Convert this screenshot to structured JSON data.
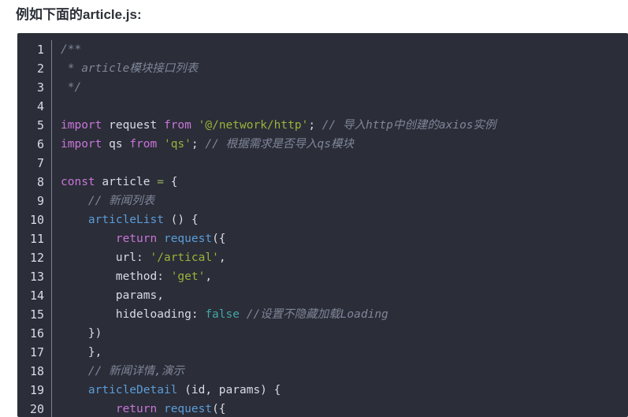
{
  "heading": {
    "text": "例如下面的article.js:"
  },
  "colors": {
    "page_background": "#ffffff",
    "heading_text": "#2c3038",
    "code_background": "#2b2d38",
    "gutter_text": "#d8dce4",
    "comment": "#7f8699",
    "keyword": "#c876d8",
    "string": "#9ab33a",
    "function": "#5b9dd9",
    "boolean": "#3fa8a8",
    "plain": "#d8dce4"
  },
  "code_block": {
    "language": "javascript",
    "filename": "article.js",
    "first_visible_line": 1,
    "last_visible_line": 20,
    "lines": [
      {
        "number": "1",
        "tokens": [
          {
            "type": "comment",
            "text": "/**"
          }
        ]
      },
      {
        "number": "2",
        "tokens": [
          {
            "type": "comment",
            "text": " * article模块接口列表"
          }
        ]
      },
      {
        "number": "3",
        "tokens": [
          {
            "type": "comment",
            "text": " */"
          }
        ]
      },
      {
        "number": "4",
        "tokens": [
          {
            "type": "plain",
            "text": ""
          }
        ]
      },
      {
        "number": "5",
        "tokens": [
          {
            "type": "keyword",
            "text": "import"
          },
          {
            "type": "plain",
            "text": " request "
          },
          {
            "type": "keyword",
            "text": "from"
          },
          {
            "type": "plain",
            "text": " "
          },
          {
            "type": "string",
            "text": "'@/network/http'"
          },
          {
            "type": "plain",
            "text": "; "
          },
          {
            "type": "comment",
            "text": "// 导入http中创建的axios实例"
          }
        ]
      },
      {
        "number": "6",
        "tokens": [
          {
            "type": "keyword",
            "text": "import"
          },
          {
            "type": "plain",
            "text": " qs "
          },
          {
            "type": "keyword",
            "text": "from"
          },
          {
            "type": "plain",
            "text": " "
          },
          {
            "type": "string",
            "text": "'qs'"
          },
          {
            "type": "plain",
            "text": "; "
          },
          {
            "type": "comment",
            "text": "// 根据需求是否导入qs模块"
          }
        ]
      },
      {
        "number": "7",
        "tokens": [
          {
            "type": "plain",
            "text": ""
          }
        ]
      },
      {
        "number": "8",
        "tokens": [
          {
            "type": "keyword",
            "text": "const"
          },
          {
            "type": "plain",
            "text": " article "
          },
          {
            "type": "operator",
            "text": "="
          },
          {
            "type": "plain",
            "text": " {"
          }
        ]
      },
      {
        "number": "9",
        "tokens": [
          {
            "type": "plain",
            "text": "    "
          },
          {
            "type": "comment",
            "text": "// 新闻列表"
          }
        ]
      },
      {
        "number": "10",
        "tokens": [
          {
            "type": "plain",
            "text": "    "
          },
          {
            "type": "func",
            "text": "articleList"
          },
          {
            "type": "plain",
            "text": " () {"
          }
        ]
      },
      {
        "number": "11",
        "tokens": [
          {
            "type": "plain",
            "text": "        "
          },
          {
            "type": "keyword",
            "text": "return"
          },
          {
            "type": "plain",
            "text": " "
          },
          {
            "type": "func",
            "text": "request"
          },
          {
            "type": "plain",
            "text": "({"
          }
        ]
      },
      {
        "number": "12",
        "tokens": [
          {
            "type": "plain",
            "text": "        url: "
          },
          {
            "type": "string",
            "text": "'/artical'"
          },
          {
            "type": "plain",
            "text": ","
          }
        ]
      },
      {
        "number": "13",
        "tokens": [
          {
            "type": "plain",
            "text": "        method: "
          },
          {
            "type": "string",
            "text": "'get'"
          },
          {
            "type": "plain",
            "text": ","
          }
        ]
      },
      {
        "number": "14",
        "tokens": [
          {
            "type": "plain",
            "text": "        params,"
          }
        ]
      },
      {
        "number": "15",
        "tokens": [
          {
            "type": "plain",
            "text": "        hideloading: "
          },
          {
            "type": "bool",
            "text": "false"
          },
          {
            "type": "plain",
            "text": " "
          },
          {
            "type": "comment",
            "text": "//设置不隐藏加载Loading"
          }
        ]
      },
      {
        "number": "16",
        "tokens": [
          {
            "type": "plain",
            "text": "    })"
          }
        ]
      },
      {
        "number": "17",
        "tokens": [
          {
            "type": "plain",
            "text": "    },"
          }
        ]
      },
      {
        "number": "18",
        "tokens": [
          {
            "type": "plain",
            "text": "    "
          },
          {
            "type": "comment",
            "text": "// 新闻详情,演示"
          }
        ]
      },
      {
        "number": "19",
        "tokens": [
          {
            "type": "plain",
            "text": "    "
          },
          {
            "type": "func",
            "text": "articleDetail"
          },
          {
            "type": "plain",
            "text": " (id, params) {"
          }
        ]
      },
      {
        "number": "20",
        "tokens": [
          {
            "type": "plain",
            "text": "        "
          },
          {
            "type": "keyword",
            "text": "return"
          },
          {
            "type": "plain",
            "text": " "
          },
          {
            "type": "func",
            "text": "request"
          },
          {
            "type": "plain",
            "text": "({"
          }
        ]
      }
    ]
  }
}
